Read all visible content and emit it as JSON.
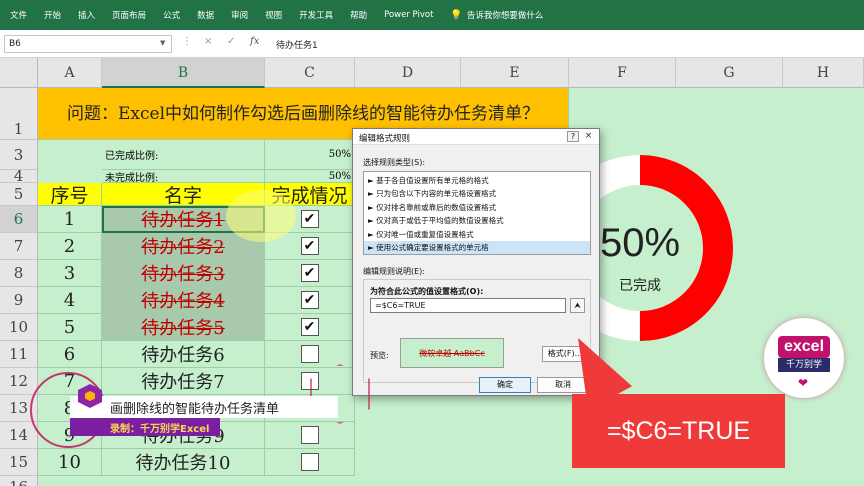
{
  "ribbon": {
    "tabs": [
      "文件",
      "开始",
      "插入",
      "页面布局",
      "公式",
      "数据",
      "审阅",
      "视图",
      "开发工具",
      "帮助",
      "Power Pivot"
    ],
    "tell_me": "告诉我你想要做什么"
  },
  "formula_bar": {
    "name_box": "B6",
    "x_glyph": "×",
    "check_glyph": "✓",
    "fx_label": "fx",
    "formula": "待办任务1"
  },
  "columns": [
    "A",
    "B",
    "C",
    "D",
    "E",
    "F",
    "G",
    "H"
  ],
  "selected_column": "B",
  "rows": [
    "1",
    "3",
    "4",
    "5",
    "6",
    "7",
    "8",
    "9",
    "10",
    "11",
    "12",
    "13",
    "14",
    "15",
    "16"
  ],
  "sheet": {
    "title": "问题：Excel中如何制作勾选后画删除线的智能待办任务清单？",
    "completed_label": "已完成比例:",
    "completed_value": "50%",
    "uncompleted_label": "未完成比例:",
    "uncompleted_value": "50%",
    "header_seq": "序号",
    "header_name": "名字",
    "header_status": "完成情况",
    "tasks": [
      {
        "num": "1",
        "name": "待办任务1",
        "done": true
      },
      {
        "num": "2",
        "name": "待办任务2",
        "done": true
      },
      {
        "num": "3",
        "name": "待办任务3",
        "done": true
      },
      {
        "num": "4",
        "name": "待办任务4",
        "done": true
      },
      {
        "num": "5",
        "name": "待办任务5",
        "done": true
      },
      {
        "num": "6",
        "name": "待办任务6",
        "done": false
      },
      {
        "num": "7",
        "name": "待办任务7",
        "done": false
      },
      {
        "num": "8",
        "name": "待办任务8",
        "done": false
      },
      {
        "num": "9",
        "name": "待办任务9",
        "done": false
      },
      {
        "num": "10",
        "name": "待办任务10",
        "done": false
      }
    ],
    "check_glyph": "✔"
  },
  "donut": {
    "percent_text": "50%",
    "label": "已完成",
    "fraction": 0.5,
    "ring_color": "#ff0000",
    "track_color": "#ffffff"
  },
  "dialog": {
    "title": "编辑格式规则",
    "help": "?",
    "close": "×",
    "select_type_label": "选择规则类型(S):",
    "rule_types": [
      "► 基于各自值设置所有单元格的格式",
      "► 只为包含以下内容的单元格设置格式",
      "► 仅对排名靠前或靠后的数值设置格式",
      "► 仅对高于或低于平均值的数值设置格式",
      "► 仅对唯一值或重复值设置格式",
      "► 使用公式确定要设置格式的单元格"
    ],
    "selected_rule_index": 5,
    "edit_desc_label": "编辑规则说明(E):",
    "formula_prompt": "为符合此公式的值设置格式(O):",
    "formula": "=$C6=TRUE",
    "collapse_glyph": "⮝",
    "preview_label": "预览:",
    "preview_text": "微软卓越 AaBbCc",
    "format_button": "格式(F)...",
    "ok_button": "确定",
    "cancel_button": "取消"
  },
  "callout": {
    "text": "=$C6=TRUE"
  },
  "logo": {
    "top": "excel",
    "bottom": "千万别学",
    "heart": "❤"
  },
  "banner": {
    "title": "画删除线的智能待办任务清单",
    "subtitle": "录制：千万别学Excel"
  },
  "colors": {
    "excel_green": "#217346",
    "sheet_bg": "#c6efce",
    "title_bg": "#ffc000",
    "header_bg": "#ffff00",
    "strike_red": "#c00000",
    "callout_red": "#f03a3a"
  }
}
